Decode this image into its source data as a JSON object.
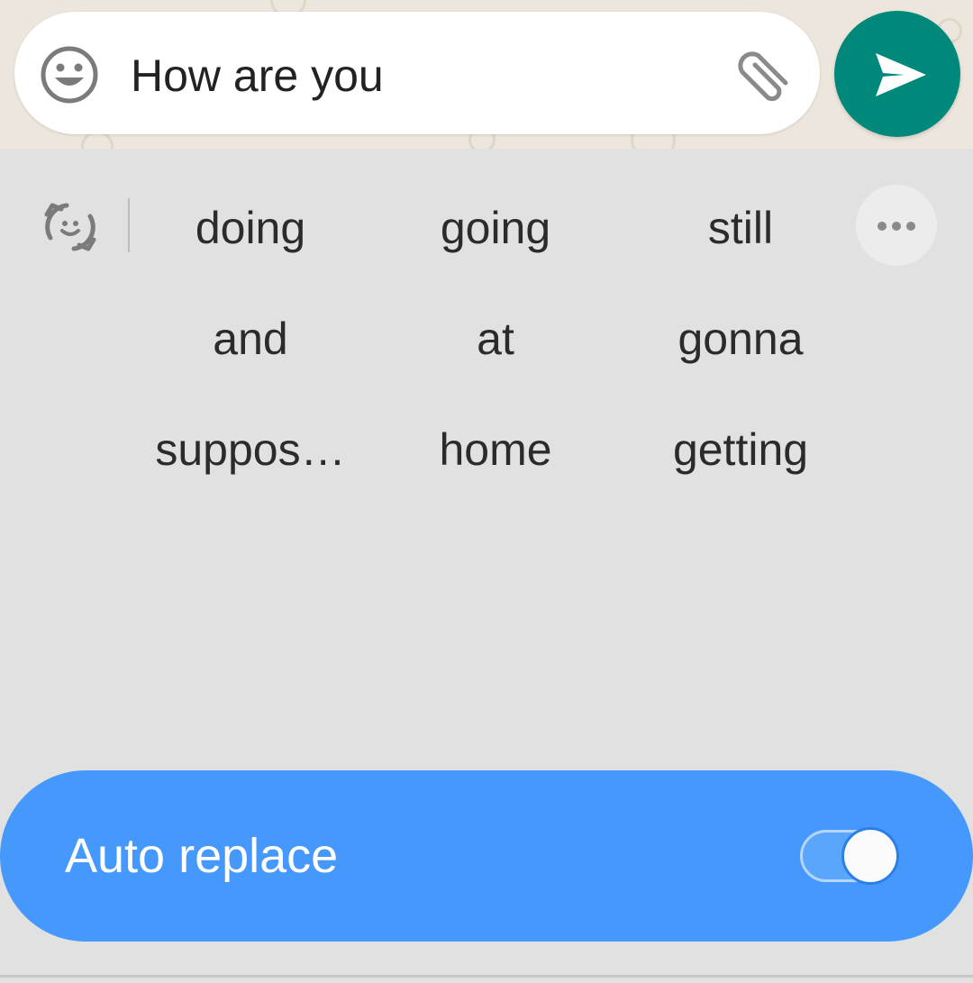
{
  "compose": {
    "message_text": "How are you",
    "emoji_icon": "smiley-icon",
    "attach_icon": "paperclip-icon",
    "send_icon": "send-arrow-icon",
    "send_color": "#00897b"
  },
  "keyboard": {
    "convert_icon": "emoji-convert-icon",
    "more_icon": "more-horizontal-icon",
    "suggestions": [
      [
        "doing",
        "going",
        "still"
      ],
      [
        "and",
        "at",
        "gonna"
      ],
      [
        "suppos…",
        "home",
        "getting"
      ]
    ],
    "auto_replace": {
      "label": "Auto replace",
      "enabled": true,
      "accent": "#4599fd"
    }
  }
}
